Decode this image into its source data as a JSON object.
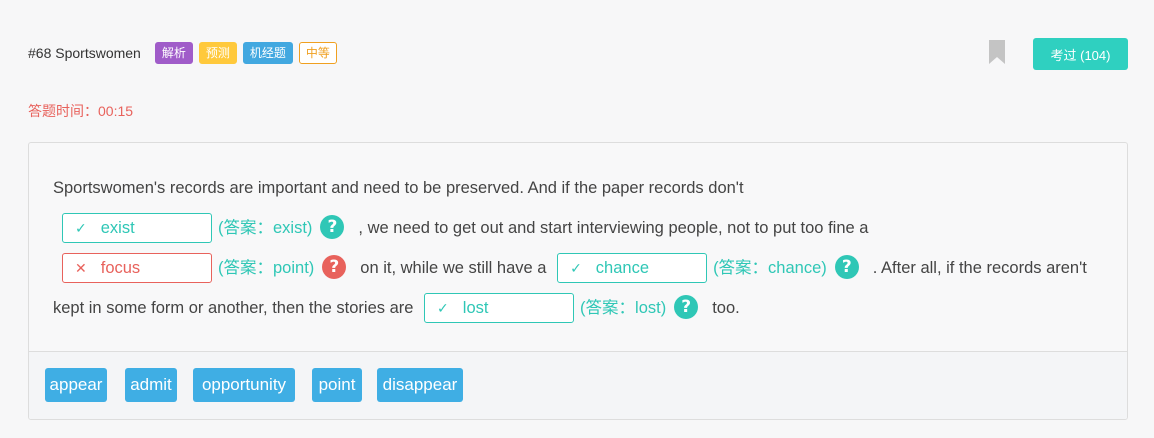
{
  "header": {
    "title": "#68 Sportswomen",
    "tags": [
      "解析",
      "预测",
      "机经题",
      "中等"
    ],
    "pass_button": "考过 (104)",
    "bookmark_icon": "bookmark-icon"
  },
  "timer": {
    "label": "答题时间：00:15"
  },
  "passage": {
    "p1": "Sportswomen's records are important and need to be preserved. And if the paper records don't",
    "blank1": {
      "mark": "✓",
      "value": "exist",
      "answer": "(答案：exist)",
      "status": "correct"
    },
    "p2": ", we need to get out and start interviewing people, not to put too fine a",
    "blank2": {
      "mark": "✕",
      "value": "focus",
      "answer": "(答案：point)",
      "status": "wrong"
    },
    "p3": "on it, while we still have a",
    "blank3": {
      "mark": "✓",
      "value": "chance",
      "answer": "(答案：chance)",
      "status": "correct"
    },
    "p4": ". After all, if the records aren't kept in some form or another, then the stories are",
    "blank4": {
      "mark": "✓",
      "value": "lost",
      "answer": "(答案：lost)",
      "status": "correct"
    },
    "p5": "too.",
    "help_glyph": "?"
  },
  "word_bank": [
    "appear",
    "admit",
    "opportunity",
    "point",
    "disappear"
  ],
  "colors": {
    "accent": "#2fc7b6",
    "wrong": "#e8625c",
    "word_chip": "#3faee4"
  }
}
